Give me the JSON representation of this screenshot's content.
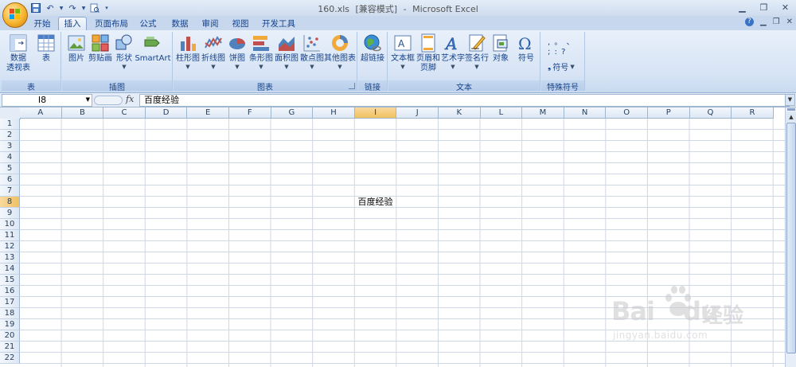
{
  "window": {
    "filename": "160.xls",
    "mode": "[兼容模式]",
    "separator": "-",
    "app": "Microsoft Excel"
  },
  "tabs": [
    {
      "label": "开始",
      "active": false
    },
    {
      "label": "插入",
      "active": true
    },
    {
      "label": "页面布局",
      "active": false
    },
    {
      "label": "公式",
      "active": false
    },
    {
      "label": "数据",
      "active": false
    },
    {
      "label": "审阅",
      "active": false
    },
    {
      "label": "视图",
      "active": false
    },
    {
      "label": "开发工具",
      "active": false
    }
  ],
  "ribbon": {
    "groups": {
      "tables": {
        "label": "表",
        "pivot_line1": "数据",
        "pivot_line2": "透视表",
        "table": "表"
      },
      "illustrations": {
        "label": "插图",
        "picture": "图片",
        "clipart": "剪贴画",
        "shapes": "形状",
        "smartart": "SmartArt"
      },
      "charts": {
        "label": "图表",
        "column": "柱形图",
        "line": "折线图",
        "pie": "饼图",
        "bar": "条形图",
        "area": "面积图",
        "scatter": "散点图",
        "other": "其他图表"
      },
      "links": {
        "label": "链接",
        "hyperlink": "超链接"
      },
      "text": {
        "label": "文本",
        "textbox": "文本框",
        "header_line1": "页眉和",
        "header_line2": "页脚",
        "wordart": "艺术字",
        "signature": "签名行",
        "object": "对象",
        "symbol": "符号"
      },
      "special": {
        "label": "特殊符号",
        "symbol": "符号",
        "glyphs_row1": ",  。  、",
        "glyphs_row2": ";  :  ?"
      }
    }
  },
  "formula_bar": {
    "name_box": "I8",
    "fx": "fx",
    "content": "百度经验"
  },
  "sheet": {
    "columns": [
      "A",
      "B",
      "C",
      "D",
      "E",
      "F",
      "G",
      "H",
      "I",
      "J",
      "K",
      "L",
      "M",
      "N",
      "O",
      "P",
      "Q",
      "R"
    ],
    "selected_column": "I",
    "rows": [
      "1",
      "2",
      "3",
      "4",
      "5",
      "6",
      "7",
      "8",
      "9",
      "10",
      "11",
      "12",
      "13",
      "14",
      "15",
      "16",
      "17",
      "18",
      "19",
      "20",
      "21",
      "22"
    ],
    "selected_row": "8",
    "cell_I8": "百度经验"
  },
  "watermark": {
    "brand": "Bai",
    "brand_b": "du",
    "cn": "经验",
    "url": "jingyan.baidu.com"
  }
}
